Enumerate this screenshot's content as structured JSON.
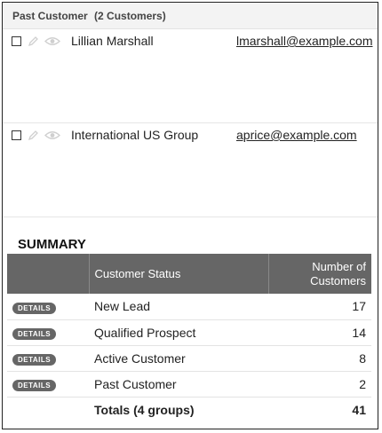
{
  "group": {
    "title": "Past Customer",
    "count_label": "(2 Customers)"
  },
  "records": [
    {
      "name": "Lillian Marshall",
      "email": "lmarshall@example.com"
    },
    {
      "name": "International US Group",
      "email": "aprice@example.com"
    }
  ],
  "icons": {
    "edit": "pencil-icon",
    "view": "eye-icon"
  },
  "summary": {
    "title": "SUMMARY",
    "headers": {
      "status": "Customer Status",
      "count": "Number of Customers"
    },
    "details_label": "DETAILS",
    "rows": [
      {
        "status": "New Lead",
        "count": "17"
      },
      {
        "status": "Qualified Prospect",
        "count": "14"
      },
      {
        "status": "Active Customer",
        "count": "8"
      },
      {
        "status": "Past Customer",
        "count": "2"
      }
    ],
    "totals": {
      "label": "Totals (4 groups)",
      "count": "41"
    }
  },
  "colors": {
    "table_header": "#666666",
    "group_header_bg": "#f3f3f3"
  }
}
